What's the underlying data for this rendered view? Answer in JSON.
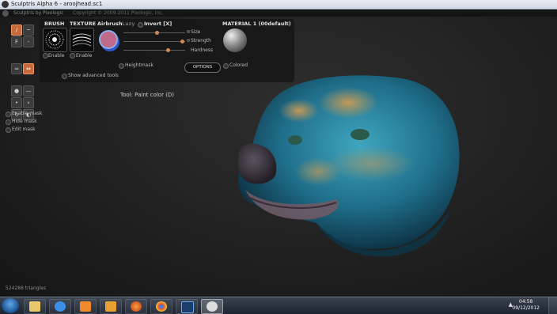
{
  "window": {
    "title": "Sculptris Alpha 6 - aroojhead.sc1"
  },
  "header": {
    "app_name": "Sculptris by Pixologic",
    "copyright": "Copyright © 2009-2011 Pixologic, Inc."
  },
  "brush_panel": {
    "brush_label": "BRUSH",
    "texture_label": "TEXTURE",
    "airbrush_label": "Airbrush",
    "lazy_label": "Lazy",
    "invert_label": "Invert [X]",
    "size_label": "Size",
    "strength_label": "Strength",
    "hardness_label": "Hardness",
    "enable_brush_label": "Enable",
    "enable_texture_label": "Enable",
    "heightmask_label": "Heightmask",
    "show_advanced_label": "Show advanced tools",
    "options_label": "OPTIONS",
    "size_value": 0.55,
    "strength_value": 0.95,
    "hardness_value": 0.72
  },
  "material": {
    "label": "MATERIAL 1 (00default)",
    "colored_label": "Colored"
  },
  "mask_options": [
    "Enable mask",
    "Hide mask",
    "Edit mask"
  ],
  "tool_caption": "Tool: Paint color (D)",
  "status": {
    "triangles": "524288 triangles"
  },
  "taskbar": {
    "time": "04:58",
    "date": "09/12/2012",
    "apps": [
      "explorer",
      "internet-explorer",
      "media-player",
      "file-manager",
      "firefox",
      "chrome",
      "photoshop",
      "sculptris"
    ]
  },
  "colors": {
    "accent": "#c8693a",
    "paint_swatch": "#c06a8a"
  }
}
